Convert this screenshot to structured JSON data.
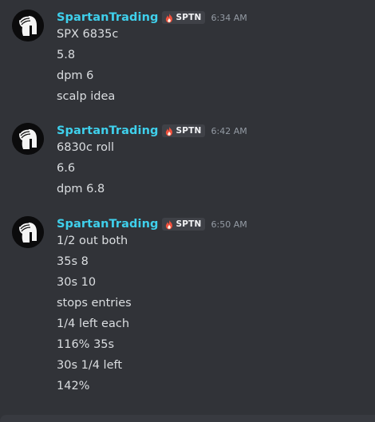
{
  "author": {
    "username": "SpartanTrading",
    "tag": "SPTN",
    "tag_icon": "fire-icon",
    "avatar_icon": "spartan-helmet-icon"
  },
  "colors": {
    "background": "#313338",
    "username": "#3fd0ec",
    "text": "#dbdee1",
    "timestamp": "#949ba4",
    "tag_bg": "#3f4147",
    "fire": "#f0503c"
  },
  "groups": [
    {
      "timestamp": "6:34 AM",
      "lines": [
        "SPX 6835c",
        "5.8",
        "dpm 6",
        "scalp idea"
      ]
    },
    {
      "timestamp": "6:42 AM",
      "lines": [
        "6830c roll",
        "6.6",
        "dpm 6.8"
      ]
    },
    {
      "timestamp": "6:50 AM",
      "lines": [
        "1/2 out both",
        "35s 8",
        "30s 10",
        "stops entries",
        "1/4 left each",
        "116% 35s",
        "30s 1/4 left",
        "142%"
      ]
    }
  ]
}
